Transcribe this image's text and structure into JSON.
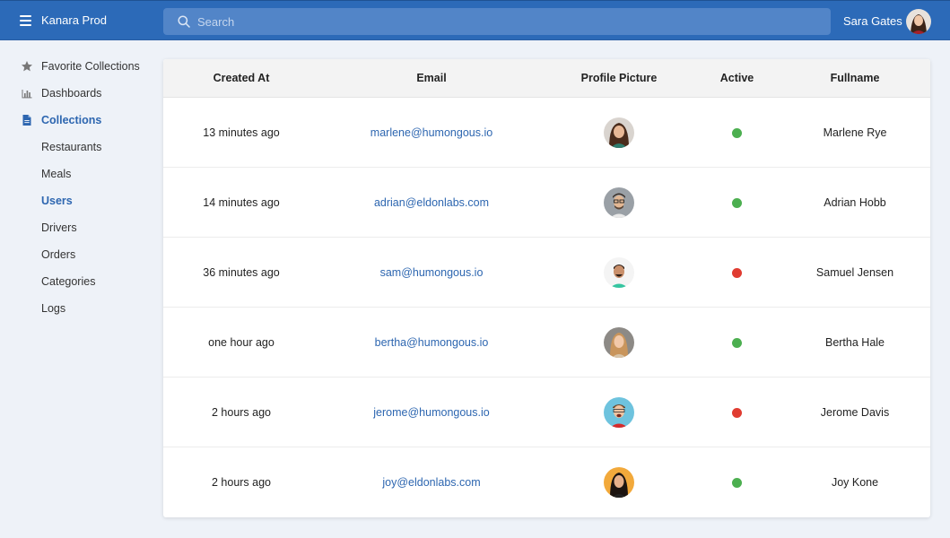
{
  "header": {
    "app_title": "Kanara Prod",
    "search_placeholder": "Search",
    "user_name": "Sara Gates"
  },
  "sidebar": {
    "items": [
      {
        "label": "Favorite Collections",
        "icon": "star-icon"
      },
      {
        "label": "Dashboards",
        "icon": "bar-chart-icon"
      },
      {
        "label": "Collections",
        "icon": "document-icon",
        "active": true
      },
      {
        "label": "Restaurants"
      },
      {
        "label": "Meals"
      },
      {
        "label": "Users",
        "active": true
      },
      {
        "label": "Drivers"
      },
      {
        "label": "Orders"
      },
      {
        "label": "Categories"
      },
      {
        "label": "Logs"
      }
    ]
  },
  "table": {
    "columns": [
      "Created At",
      "Email",
      "Profile Picture",
      "Active",
      "Fullname"
    ],
    "rows": [
      {
        "created_at": "13 minutes ago",
        "email": "marlene@humongous.io",
        "active": true,
        "fullname": "Marlene Rye"
      },
      {
        "created_at": "14 minutes ago",
        "email": "adrian@eldonlabs.com",
        "active": true,
        "fullname": "Adrian Hobb"
      },
      {
        "created_at": "36 minutes ago",
        "email": "sam@humongous.io",
        "active": false,
        "fullname": "Samuel Jensen"
      },
      {
        "created_at": "one hour ago",
        "email": "bertha@humongous.io",
        "active": true,
        "fullname": "Bertha Hale"
      },
      {
        "created_at": "2 hours ago",
        "email": "jerome@humongous.io",
        "active": false,
        "fullname": "Jerome Davis"
      },
      {
        "created_at": "2 hours ago",
        "email": "joy@eldonlabs.com",
        "active": true,
        "fullname": "Joy Kone"
      }
    ]
  },
  "colors": {
    "header_bg": "#2c6ab8",
    "accent": "#2d66b0",
    "active_green": "#4caf50",
    "inactive_red": "#e03c31"
  }
}
